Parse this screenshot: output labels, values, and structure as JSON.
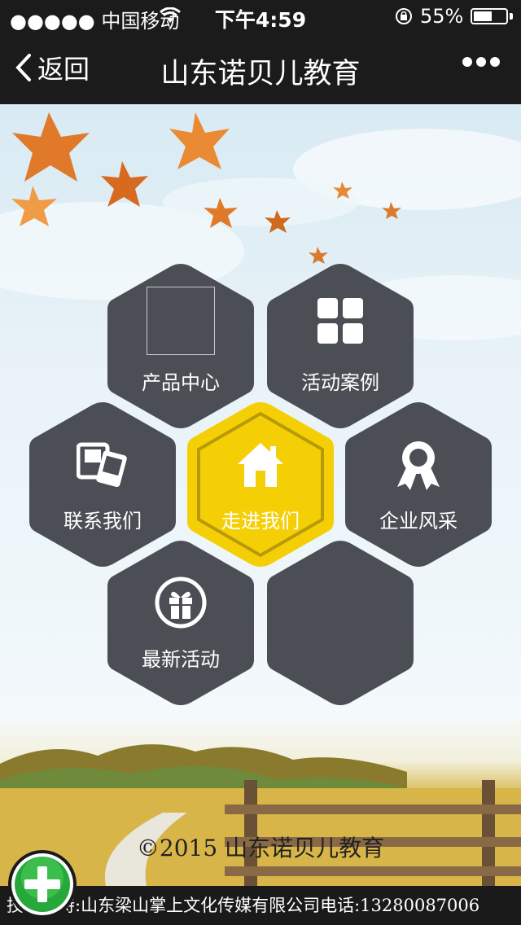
{
  "status_bar": {
    "carrier": "●●●●● 中国移动",
    "time": "下午4:59",
    "battery_percent": "55%"
  },
  "nav": {
    "back_label": "返回",
    "title": "山东诺贝儿教育",
    "more_label": "•••"
  },
  "menu": {
    "product_center": "产品中心",
    "activity_cases": "活动案例",
    "contact_us": "联系我们",
    "about_us": "走进我们",
    "company_style": "企业风采",
    "latest_activities": "最新活动"
  },
  "footer": {
    "copyright": "©2015 山东诺贝儿教育",
    "support_ticker": "技术支持:山东梁山掌上文化传媒有限公司电话:13280087006"
  },
  "colors": {
    "hex_dark": "#4b4e55",
    "hex_active": "#f5cf06"
  }
}
